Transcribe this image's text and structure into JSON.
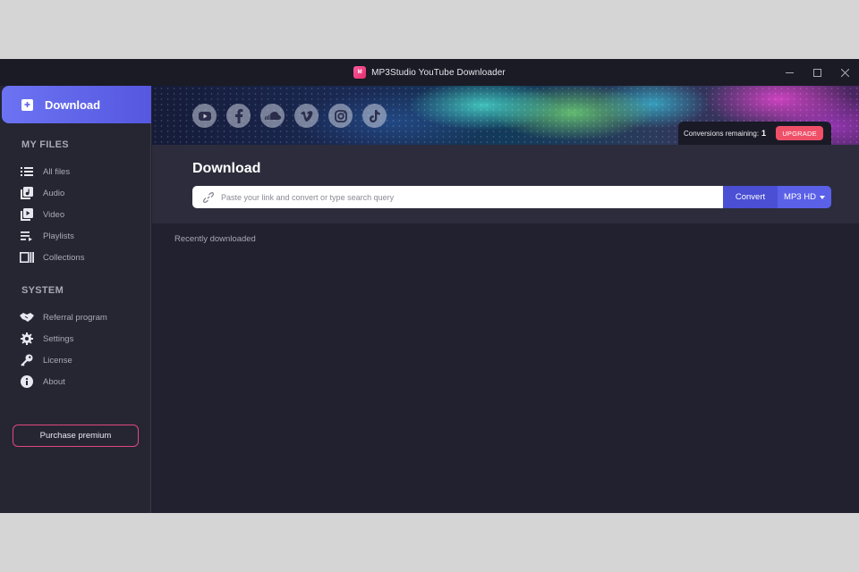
{
  "window": {
    "title": "MP3Studio YouTube Downloader",
    "logo_text": "M"
  },
  "sidebar": {
    "download_label": "Download",
    "my_files_title": "MY FILES",
    "my_files": [
      {
        "label": "All files",
        "icon": "list-icon"
      },
      {
        "label": "Audio",
        "icon": "music-note-icon"
      },
      {
        "label": "Video",
        "icon": "play-icon"
      },
      {
        "label": "Playlists",
        "icon": "playlist-icon"
      },
      {
        "label": "Collections",
        "icon": "collections-icon"
      }
    ],
    "system_title": "SYSTEM",
    "system": [
      {
        "label": "Referral program",
        "icon": "handshake-icon"
      },
      {
        "label": "Settings",
        "icon": "gear-icon"
      },
      {
        "label": "License",
        "icon": "key-icon"
      },
      {
        "label": "About",
        "icon": "info-icon"
      }
    ],
    "purchase_label": "Purchase premium"
  },
  "banner": {
    "socials": [
      "youtube-icon",
      "facebook-icon",
      "soundcloud-icon",
      "vimeo-icon",
      "instagram-icon",
      "tiktok-icon"
    ],
    "conversions_label": "Conversions remaining:",
    "conversions_count": "1",
    "upgrade_label": "UPGRADE"
  },
  "download": {
    "title": "Download",
    "search_placeholder": "Paste your link and convert or type search query",
    "convert_label": "Convert",
    "format_label": "MP3 HD"
  },
  "recent": {
    "label": "Recently downloaded"
  },
  "colors": {
    "accent": "#5b60e8",
    "upgrade": "#ef5068",
    "purchase_border": "#e0487c",
    "background": "#21212d"
  }
}
